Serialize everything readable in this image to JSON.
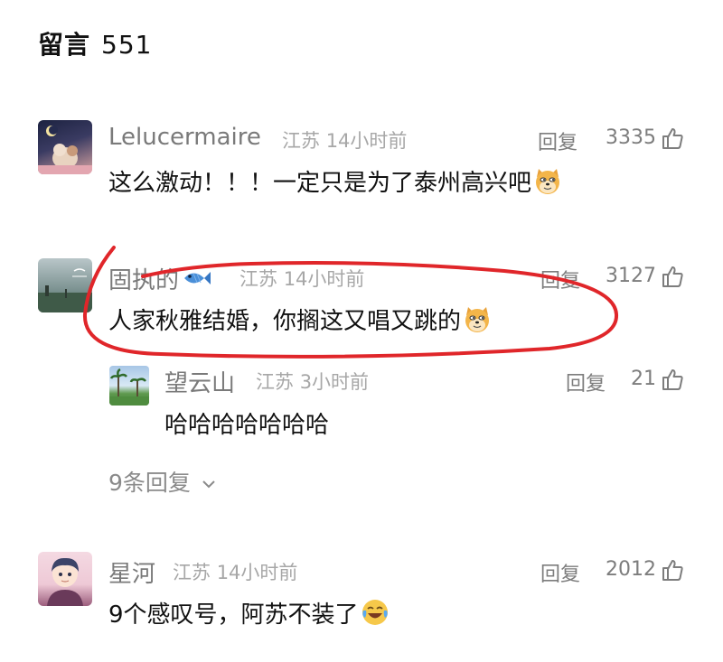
{
  "header": {
    "title": "留言",
    "count": "551"
  },
  "comments": [
    {
      "user": "Lelucermaire",
      "location": "江苏",
      "time": "14小时前",
      "text": "这么激动！！！一定只是为了泰州高兴吧",
      "reply_label": "回复",
      "likes": "3335",
      "avatar_icon": "cartoon-animal-avatar",
      "emoji_icon": "doge-emoji-icon"
    },
    {
      "user": "固执的",
      "location": "江苏",
      "time": "14小时前",
      "text": "人家秋雅结婚，你搁这又唱又跳的",
      "reply_label": "回复",
      "likes": "3127",
      "avatar_icon": "landscape-photo-avatar",
      "name_emoji_icon": "fish-emoji-icon",
      "emoji_icon": "doge-emoji-icon",
      "reply": {
        "user": "望云山",
        "location": "江苏",
        "time": "3小时前",
        "text": "哈哈哈哈哈哈哈",
        "reply_label": "回复",
        "likes": "21",
        "avatar_icon": "palm-trees-photo-avatar"
      },
      "more_replies": "9条回复"
    },
    {
      "user": "星河",
      "location": "江苏",
      "time": "14小时前",
      "text": "9个感叹号，阿苏不装了",
      "reply_label": "回复",
      "likes": "2012",
      "avatar_icon": "anime-boy-avatar",
      "emoji_icon": "laughing-crying-emoji-icon"
    }
  ],
  "colors": {
    "annotation": "#e0262a",
    "muted": "#7d7d7d"
  }
}
